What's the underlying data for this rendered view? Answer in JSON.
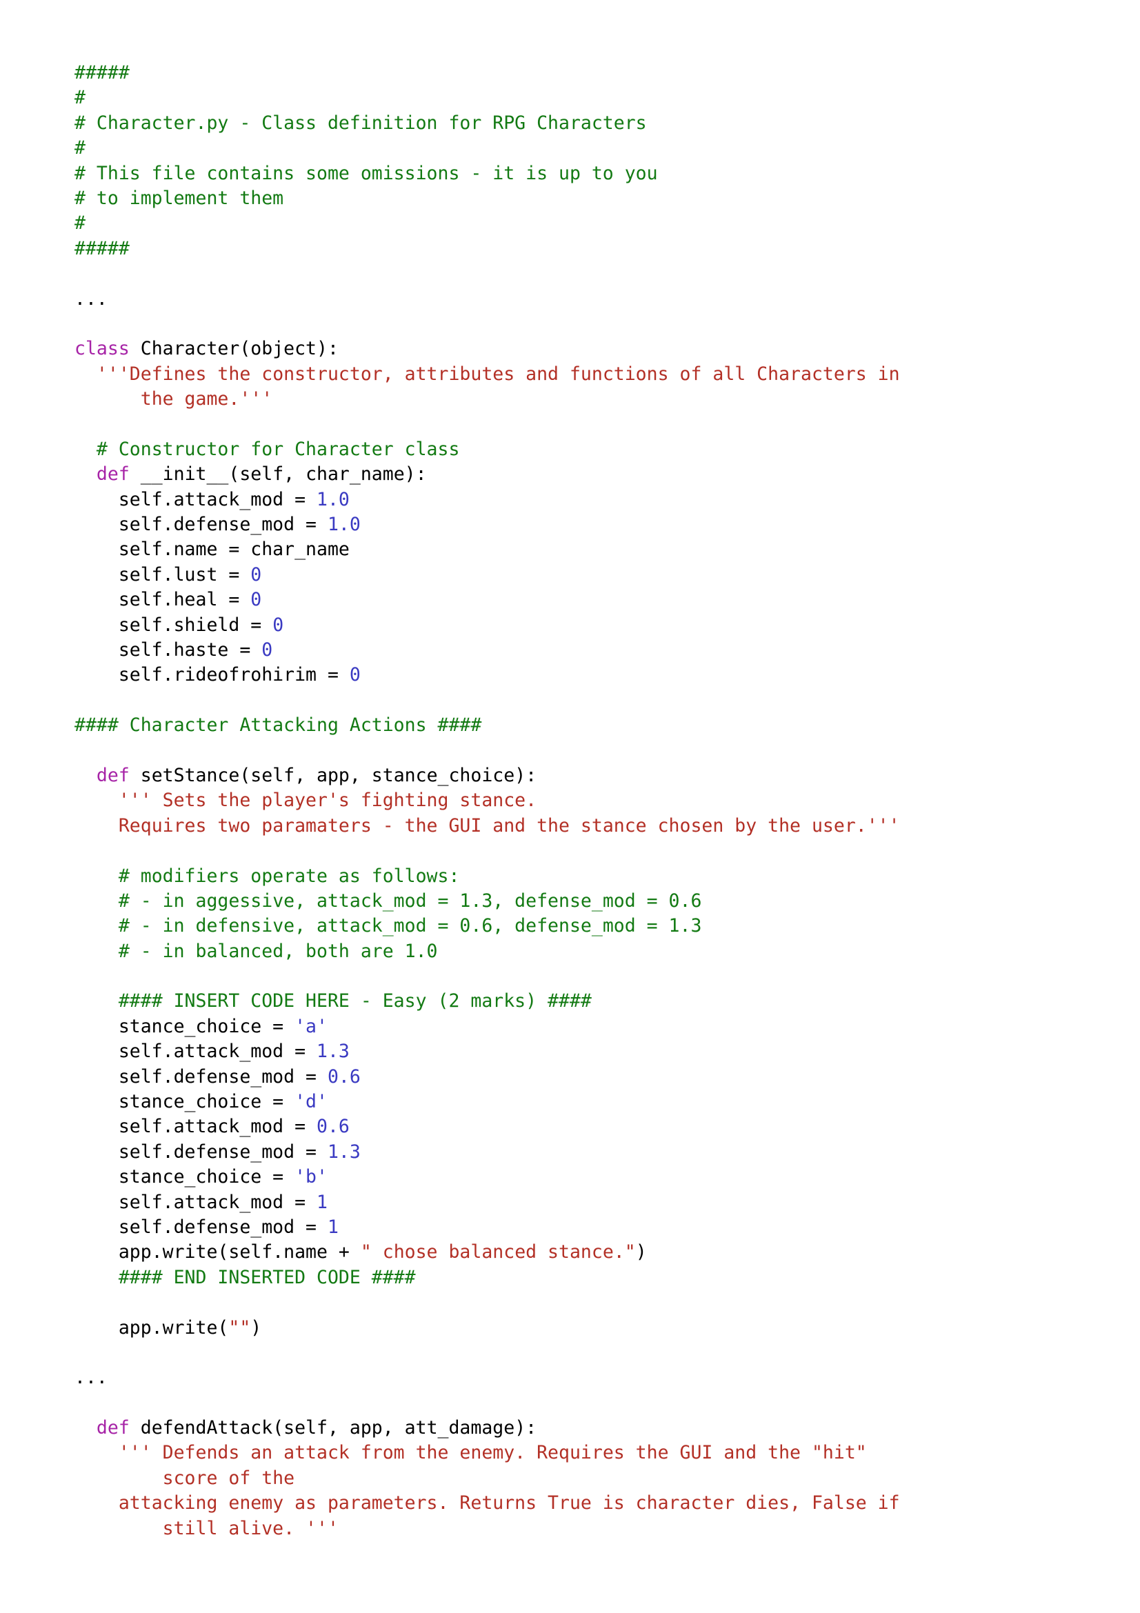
{
  "document": {
    "kind": "python-source-listing",
    "filename": "Character.py",
    "background_color": "#ffffff",
    "font_family_kind": "monospace"
  },
  "colors": {
    "comment": "#137a13",
    "keyword": "#a724a7",
    "identifier": "#000000",
    "docstring": "#b33026",
    "double_quoted_string": "#b33026",
    "single_quoted_string": "#3a3ac2",
    "number": "#3a3ac2",
    "background": "#ffffff"
  },
  "lines": [
    {
      "id": "l1",
      "tokens": [
        {
          "t": "comment",
          "s": "#####"
        }
      ]
    },
    {
      "id": "l2",
      "tokens": [
        {
          "t": "comment",
          "s": "#"
        }
      ]
    },
    {
      "id": "l3",
      "tokens": [
        {
          "t": "comment",
          "s": "# Character.py - Class definition for RPG Characters"
        }
      ]
    },
    {
      "id": "l4",
      "tokens": [
        {
          "t": "comment",
          "s": "#"
        }
      ]
    },
    {
      "id": "l5",
      "tokens": [
        {
          "t": "comment",
          "s": "# This file contains some omissions - it is up to you"
        }
      ]
    },
    {
      "id": "l6",
      "tokens": [
        {
          "t": "comment",
          "s": "# to implement them"
        }
      ]
    },
    {
      "id": "l7",
      "tokens": [
        {
          "t": "comment",
          "s": "#"
        }
      ]
    },
    {
      "id": "l8",
      "tokens": [
        {
          "t": "comment",
          "s": "#####"
        }
      ]
    },
    {
      "id": "l9",
      "tokens": [
        {
          "t": "plain",
          "s": ""
        }
      ]
    },
    {
      "id": "l10",
      "tokens": [
        {
          "t": "ellipsis",
          "s": "..."
        }
      ]
    },
    {
      "id": "l11",
      "tokens": [
        {
          "t": "plain",
          "s": ""
        }
      ]
    },
    {
      "id": "l12",
      "tokens": [
        {
          "t": "keyword",
          "s": "class"
        },
        {
          "t": "plain",
          "s": " Character(object):"
        }
      ]
    },
    {
      "id": "l13",
      "tokens": [
        {
          "t": "plain",
          "s": "  "
        },
        {
          "t": "doc",
          "s": "'''Defines the constructor, attributes and functions of all Characters in"
        }
      ]
    },
    {
      "id": "l14",
      "tokens": [
        {
          "t": "plain",
          "s": "      "
        },
        {
          "t": "doc",
          "s": "the game.'''"
        }
      ]
    },
    {
      "id": "l15",
      "tokens": [
        {
          "t": "plain",
          "s": ""
        }
      ]
    },
    {
      "id": "l16",
      "tokens": [
        {
          "t": "plain",
          "s": "  "
        },
        {
          "t": "comment",
          "s": "# Constructor for Character class"
        }
      ]
    },
    {
      "id": "l17",
      "tokens": [
        {
          "t": "plain",
          "s": "  "
        },
        {
          "t": "keyword",
          "s": "def"
        },
        {
          "t": "plain",
          "s": " __init__(self, char_name):"
        }
      ]
    },
    {
      "id": "l18",
      "tokens": [
        {
          "t": "plain",
          "s": "    self.attack_mod = "
        },
        {
          "t": "num",
          "s": "1.0"
        }
      ]
    },
    {
      "id": "l19",
      "tokens": [
        {
          "t": "plain",
          "s": "    self.defense_mod = "
        },
        {
          "t": "num",
          "s": "1.0"
        }
      ]
    },
    {
      "id": "l20",
      "tokens": [
        {
          "t": "plain",
          "s": "    self.name = char_name"
        }
      ]
    },
    {
      "id": "l21",
      "tokens": [
        {
          "t": "plain",
          "s": "    self.lust = "
        },
        {
          "t": "num",
          "s": "0"
        }
      ]
    },
    {
      "id": "l22",
      "tokens": [
        {
          "t": "plain",
          "s": "    self.heal = "
        },
        {
          "t": "num",
          "s": "0"
        }
      ]
    },
    {
      "id": "l23",
      "tokens": [
        {
          "t": "plain",
          "s": "    self.shield = "
        },
        {
          "t": "num",
          "s": "0"
        }
      ]
    },
    {
      "id": "l24",
      "tokens": [
        {
          "t": "plain",
          "s": "    self.haste = "
        },
        {
          "t": "num",
          "s": "0"
        }
      ]
    },
    {
      "id": "l25",
      "tokens": [
        {
          "t": "plain",
          "s": "    self.rideofrohirim = "
        },
        {
          "t": "num",
          "s": "0"
        }
      ]
    },
    {
      "id": "l26",
      "tokens": [
        {
          "t": "plain",
          "s": ""
        }
      ]
    },
    {
      "id": "l27",
      "tokens": [
        {
          "t": "comment",
          "s": "#### Character Attacking Actions ####"
        }
      ]
    },
    {
      "id": "l28",
      "tokens": [
        {
          "t": "plain",
          "s": ""
        }
      ]
    },
    {
      "id": "l29",
      "tokens": [
        {
          "t": "plain",
          "s": "  "
        },
        {
          "t": "keyword",
          "s": "def"
        },
        {
          "t": "plain",
          "s": " setStance(self, app, stance_choice):"
        }
      ]
    },
    {
      "id": "l30",
      "tokens": [
        {
          "t": "plain",
          "s": "    "
        },
        {
          "t": "doc",
          "s": "''' Sets the player's fighting stance."
        }
      ]
    },
    {
      "id": "l31",
      "tokens": [
        {
          "t": "plain",
          "s": "    "
        },
        {
          "t": "doc",
          "s": "Requires two paramaters - the GUI and the stance chosen by the user.'''"
        }
      ]
    },
    {
      "id": "l32",
      "tokens": [
        {
          "t": "plain",
          "s": ""
        }
      ]
    },
    {
      "id": "l33",
      "tokens": [
        {
          "t": "plain",
          "s": "    "
        },
        {
          "t": "comment",
          "s": "# modifiers operate as follows:"
        }
      ]
    },
    {
      "id": "l34",
      "tokens": [
        {
          "t": "plain",
          "s": "    "
        },
        {
          "t": "comment",
          "s": "# - in aggessive, attack_mod = 1.3, defense_mod = 0.6"
        }
      ]
    },
    {
      "id": "l35",
      "tokens": [
        {
          "t": "plain",
          "s": "    "
        },
        {
          "t": "comment",
          "s": "# - in defensive, attack_mod = 0.6, defense_mod = 1.3"
        }
      ]
    },
    {
      "id": "l36",
      "tokens": [
        {
          "t": "plain",
          "s": "    "
        },
        {
          "t": "comment",
          "s": "# - in balanced, both are 1.0"
        }
      ]
    },
    {
      "id": "l37",
      "tokens": [
        {
          "t": "plain",
          "s": ""
        }
      ]
    },
    {
      "id": "l38",
      "tokens": [
        {
          "t": "plain",
          "s": "    "
        },
        {
          "t": "comment",
          "s": "#### INSERT CODE HERE - Easy (2 marks) ####"
        }
      ]
    },
    {
      "id": "l39",
      "tokens": [
        {
          "t": "plain",
          "s": "    stance_choice = "
        },
        {
          "t": "str_s",
          "s": "'a'"
        }
      ]
    },
    {
      "id": "l40",
      "tokens": [
        {
          "t": "plain",
          "s": "    self.attack_mod = "
        },
        {
          "t": "num",
          "s": "1.3"
        }
      ]
    },
    {
      "id": "l41",
      "tokens": [
        {
          "t": "plain",
          "s": "    self.defense_mod = "
        },
        {
          "t": "num",
          "s": "0.6"
        }
      ]
    },
    {
      "id": "l42",
      "tokens": [
        {
          "t": "plain",
          "s": "    stance_choice = "
        },
        {
          "t": "str_s",
          "s": "'d'"
        }
      ]
    },
    {
      "id": "l43",
      "tokens": [
        {
          "t": "plain",
          "s": "    self.attack_mod = "
        },
        {
          "t": "num",
          "s": "0.6"
        }
      ]
    },
    {
      "id": "l44",
      "tokens": [
        {
          "t": "plain",
          "s": "    self.defense_mod = "
        },
        {
          "t": "num",
          "s": "1.3"
        }
      ]
    },
    {
      "id": "l45",
      "tokens": [
        {
          "t": "plain",
          "s": "    stance_choice = "
        },
        {
          "t": "str_s",
          "s": "'b'"
        }
      ]
    },
    {
      "id": "l46",
      "tokens": [
        {
          "t": "plain",
          "s": "    self.attack_mod = "
        },
        {
          "t": "num",
          "s": "1"
        }
      ]
    },
    {
      "id": "l47",
      "tokens": [
        {
          "t": "plain",
          "s": "    self.defense_mod = "
        },
        {
          "t": "num",
          "s": "1"
        }
      ]
    },
    {
      "id": "l48",
      "tokens": [
        {
          "t": "plain",
          "s": "    app.write(self.name + "
        },
        {
          "t": "str_d",
          "s": "\" chose balanced stance.\""
        },
        {
          "t": "plain",
          "s": ")"
        }
      ]
    },
    {
      "id": "l49",
      "tokens": [
        {
          "t": "plain",
          "s": "    "
        },
        {
          "t": "comment",
          "s": "#### END INSERTED CODE ####"
        }
      ]
    },
    {
      "id": "l50",
      "tokens": [
        {
          "t": "plain",
          "s": ""
        }
      ]
    },
    {
      "id": "l51",
      "tokens": [
        {
          "t": "plain",
          "s": "    app.write("
        },
        {
          "t": "str_d",
          "s": "\"\""
        },
        {
          "t": "plain",
          "s": ")"
        }
      ]
    },
    {
      "id": "l52",
      "tokens": [
        {
          "t": "plain",
          "s": ""
        }
      ]
    },
    {
      "id": "l53",
      "tokens": [
        {
          "t": "ellipsis",
          "s": "..."
        }
      ]
    },
    {
      "id": "l54",
      "tokens": [
        {
          "t": "plain",
          "s": ""
        }
      ]
    },
    {
      "id": "l55",
      "tokens": [
        {
          "t": "plain",
          "s": "  "
        },
        {
          "t": "keyword",
          "s": "def"
        },
        {
          "t": "plain",
          "s": " defendAttack(self, app, att_damage):"
        }
      ]
    },
    {
      "id": "l56",
      "tokens": [
        {
          "t": "plain",
          "s": "    "
        },
        {
          "t": "doc",
          "s": "''' Defends an attack from the enemy. Requires the GUI and the \"hit\""
        }
      ]
    },
    {
      "id": "l57",
      "tokens": [
        {
          "t": "plain",
          "s": "        "
        },
        {
          "t": "doc",
          "s": "score of the"
        }
      ]
    },
    {
      "id": "l58",
      "tokens": [
        {
          "t": "plain",
          "s": "    "
        },
        {
          "t": "doc",
          "s": "attacking enemy as parameters. Returns True is character dies, False if"
        }
      ]
    },
    {
      "id": "l59",
      "tokens": [
        {
          "t": "plain",
          "s": "        "
        },
        {
          "t": "doc",
          "s": "still alive. '''"
        }
      ]
    }
  ]
}
